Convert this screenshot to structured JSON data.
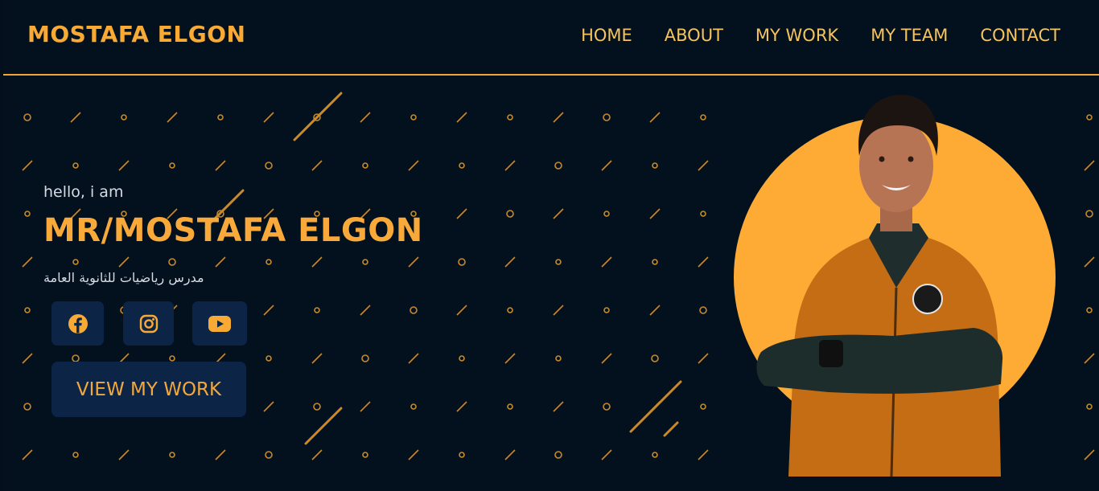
{
  "header": {
    "logo": "MOSTAFA ELGON",
    "nav": [
      "HOME",
      "ABOUT",
      "MY WORK",
      "MY TEAM",
      "CONTACT"
    ]
  },
  "hero": {
    "greeting": "hello, i am",
    "name": "MR/MOSTAFA ELGON",
    "subtitle": "مدرس رياضيات للثانوية العامة",
    "cta_label": "VIEW MY WORK",
    "socials": [
      "facebook-icon",
      "instagram-icon",
      "youtube-icon"
    ]
  },
  "colors": {
    "background": "#03111f",
    "accent": "#f8aa35",
    "button_bg": "#0c2547",
    "text_light": "#d6dae3"
  }
}
